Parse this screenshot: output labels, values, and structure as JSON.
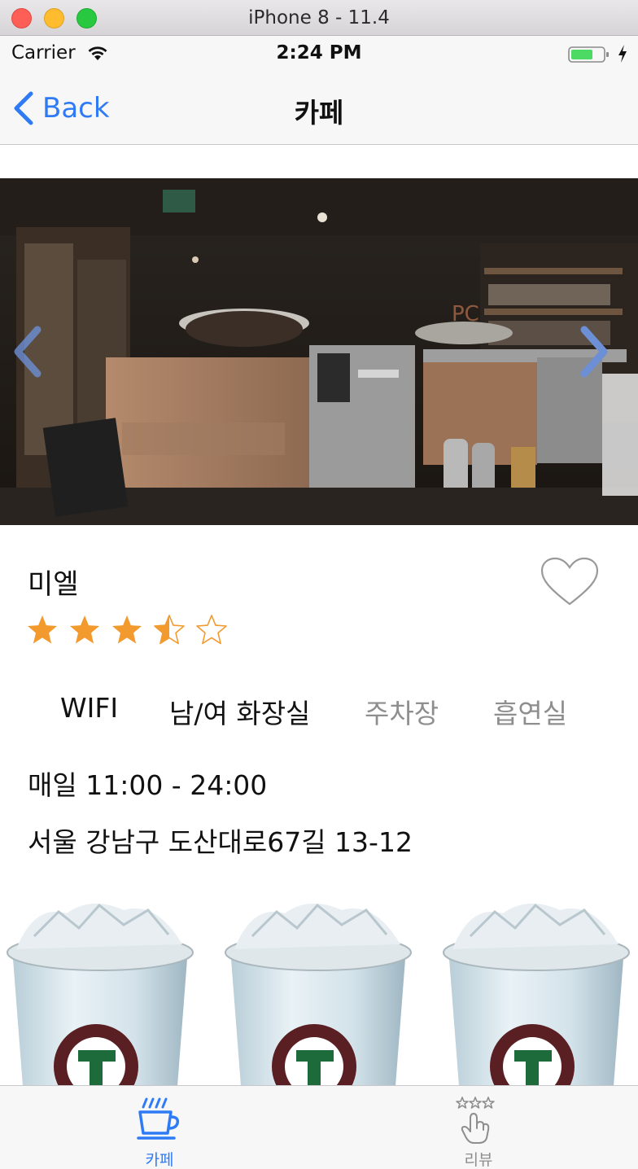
{
  "window": {
    "title": "iPhone 8 - 11.4"
  },
  "status_bar": {
    "carrier": "Carrier",
    "time": "2:24 PM"
  },
  "nav": {
    "back_label": "Back",
    "title": "카페"
  },
  "cafe": {
    "name": "미엘",
    "rating": 3.5,
    "rating_max": 5,
    "favorite": false,
    "amenities": [
      {
        "label": "WIFI",
        "available": true
      },
      {
        "label": "남/여 화장실",
        "available": true
      },
      {
        "label": "주차장",
        "available": false
      },
      {
        "label": "흡연실",
        "available": false
      }
    ],
    "hours": "매일 11:00 - 24:00",
    "address": "서울 강남구 도산대로67길 13-12"
  },
  "menu_items": [
    {
      "name": "iced-drink"
    },
    {
      "name": "iced-drink"
    },
    {
      "name": "iced-drink"
    }
  ],
  "tab_bar": {
    "tabs": [
      {
        "label": "카페",
        "icon": "coffee-cup-icon",
        "selected": true
      },
      {
        "label": "리뷰",
        "icon": "review-stars-hand-icon",
        "selected": false
      }
    ]
  },
  "colors": {
    "accent": "#2f7bf5",
    "star": "#f29a2e",
    "inactive": "#8e8e8e",
    "battery": "#4cd964"
  }
}
